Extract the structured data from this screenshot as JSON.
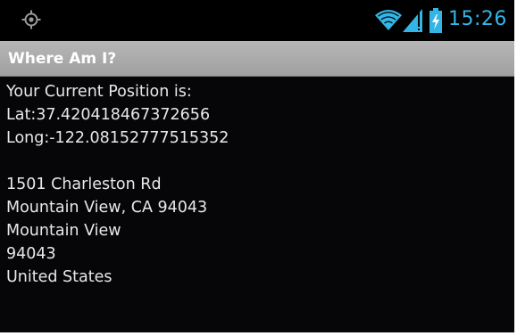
{
  "status_bar": {
    "time": "15:26",
    "icons": [
      "gps-icon",
      "wifi-icon",
      "signal-icon",
      "battery-charging-icon"
    ],
    "accent_color": "#33b5e5"
  },
  "app_bar": {
    "title": "Where Am I?"
  },
  "position": {
    "heading": "Your Current Position is:",
    "latitude": "Lat:37.420418467372656",
    "longitude": "Long:-122.08152777515352"
  },
  "address": {
    "street": "1501 Charleston Rd",
    "city_state_zip": "Mountain View, CA 94043",
    "locality": "Mountain View",
    "postal_code": "94043",
    "country": "United States"
  }
}
